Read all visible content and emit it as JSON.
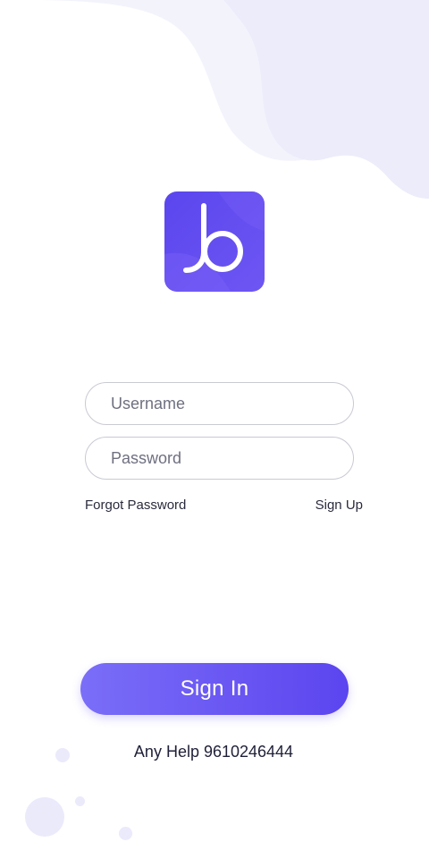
{
  "logo": {
    "icon": "b-letter-logo-icon",
    "color": "#6a4ff0"
  },
  "login_form": {
    "username_placeholder": "Username",
    "password_placeholder": "Password",
    "forgot_password_label": "Forgot Password",
    "sign_up_label": "Sign Up",
    "sign_in_label": "Sign In"
  },
  "footer": {
    "help_text": "Any Help 9610246444"
  },
  "colors": {
    "accent": "#6a57f3",
    "background": "#ffffff",
    "wave": "#eeeefb"
  }
}
